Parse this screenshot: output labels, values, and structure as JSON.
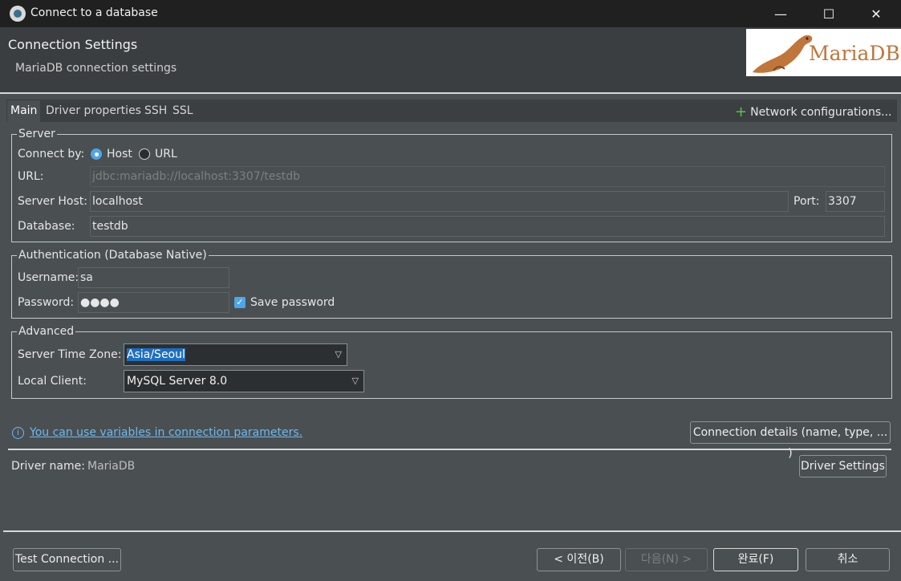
{
  "window": {
    "title": "Connect to a database",
    "controls": {
      "minimize": "—",
      "maximize": "☐",
      "close": "✕"
    }
  },
  "header": {
    "title": "Connection Settings",
    "subtitle": "MariaDB connection settings",
    "logo_text": "MariaDB"
  },
  "tabs": [
    {
      "label": "Main",
      "active": true
    },
    {
      "label": "Driver properties",
      "active": false
    },
    {
      "label": "SSH",
      "active": false
    },
    {
      "label": "SSL",
      "active": false
    }
  ],
  "network_config_label": "Network configurations...",
  "server": {
    "legend": "Server",
    "connect_by_label": "Connect by:",
    "option_host": "Host",
    "option_url": "URL",
    "selected": "Host",
    "url_label": "URL:",
    "url_value": "jdbc:mariadb://localhost:3307/testdb",
    "host_label": "Server Host:",
    "host_value": "localhost",
    "port_label": "Port:",
    "port_value": "3307",
    "database_label": "Database:",
    "database_value": "testdb"
  },
  "auth": {
    "legend": "Authentication (Database Native)",
    "username_label": "Username:",
    "username_value": "sa",
    "password_label": "Password:",
    "password_value": "●●●●",
    "save_password_label": "Save password",
    "save_password_checked": true
  },
  "advanced": {
    "legend": "Advanced",
    "timezone_label": "Server Time Zone:",
    "timezone_value": "Asia/Seoul",
    "local_client_label": "Local Client:",
    "local_client_value": "MySQL Server 8.0"
  },
  "variables_link": "You can use variables in connection parameters.",
  "connection_details_button": "Connection details (name, type, ... )",
  "driver": {
    "label": "Driver name:",
    "value": "MariaDB",
    "settings_button": "Driver Settings"
  },
  "footer": {
    "test_connection": "Test Connection ...",
    "back": "< 이전(B)",
    "next": "다음(N) >",
    "finish": "완료(F)",
    "cancel": "취소"
  },
  "colors": {
    "accent": "#4ea6e8",
    "link": "#6eb8ee",
    "plus": "#5fc04d",
    "background": "#4a4f52",
    "titlebar": "#202020"
  }
}
